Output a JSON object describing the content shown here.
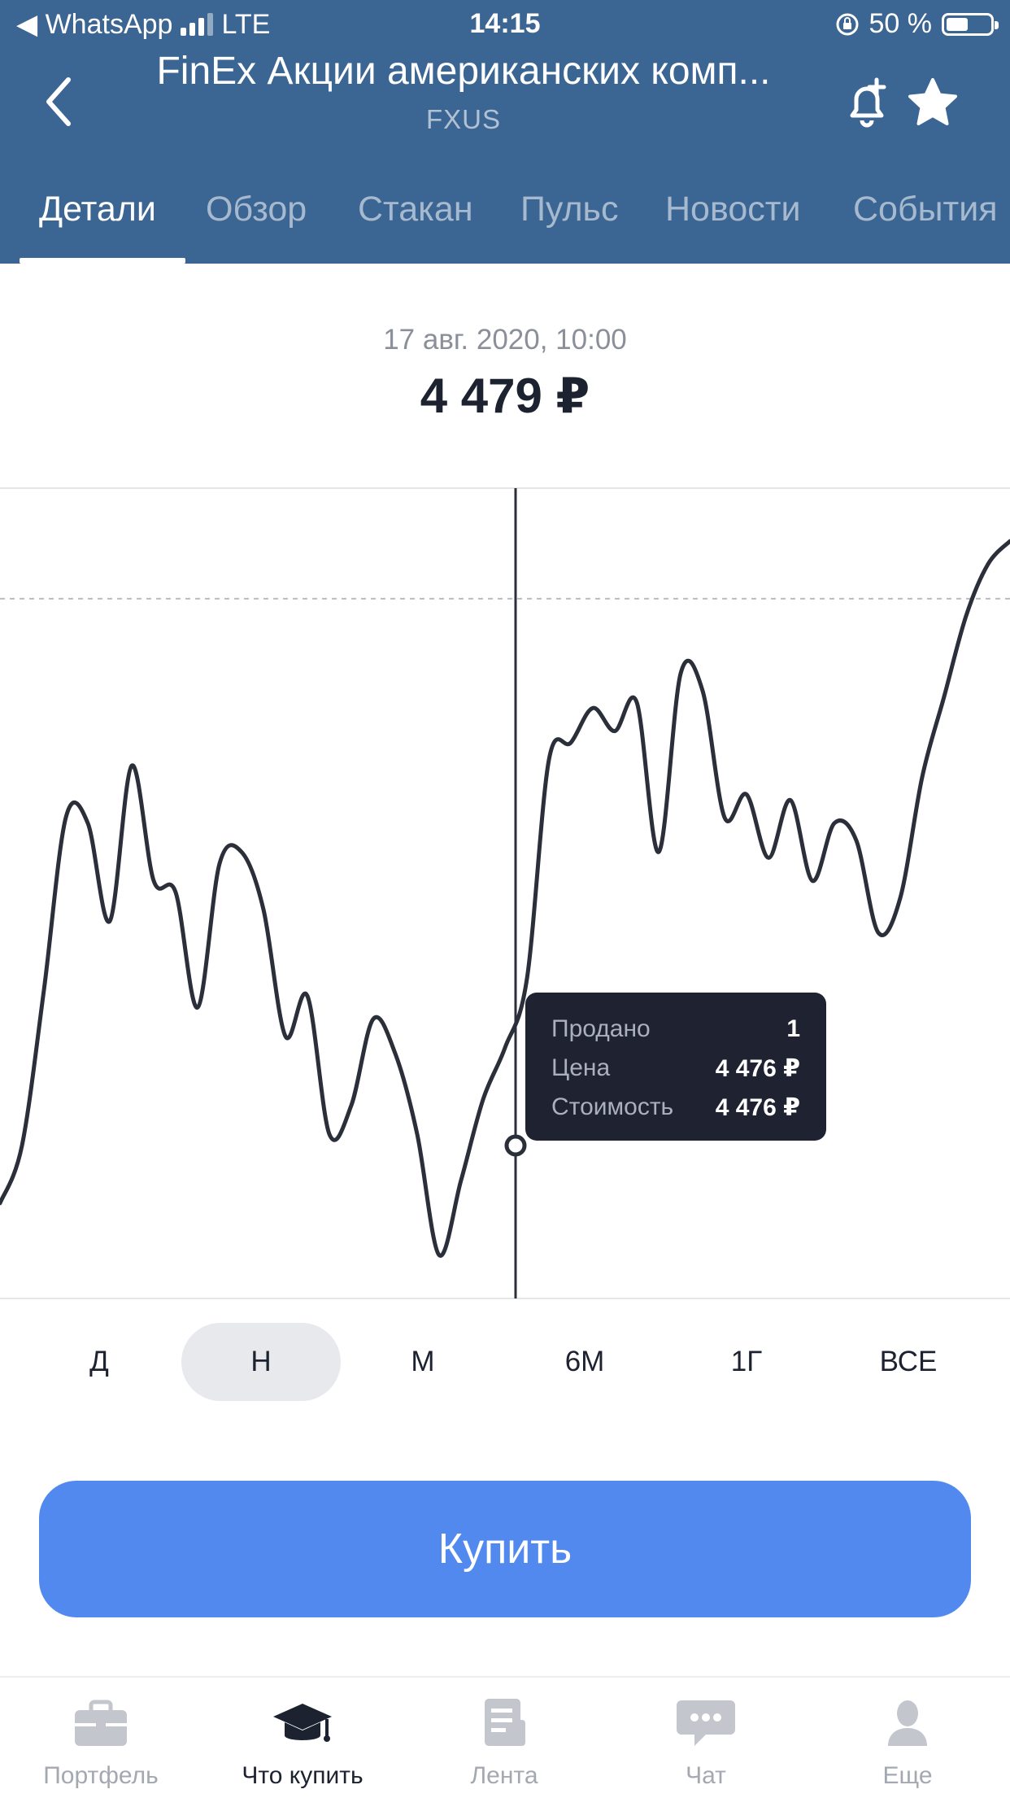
{
  "status_bar": {
    "back_app": "◀ WhatsApp",
    "network": "LTE",
    "time": "14:15",
    "battery": "50 %",
    "battery_level": 0.5
  },
  "header": {
    "title": "FinEx Акции американских комп...",
    "ticker": "FXUS",
    "icons": [
      "back-chevron-icon",
      "bell-plus-icon",
      "star-icon"
    ]
  },
  "tabs": [
    {
      "label": "Детали",
      "active": true
    },
    {
      "label": "Обзор",
      "active": false
    },
    {
      "label": "Стакан",
      "active": false
    },
    {
      "label": "Пульс",
      "active": false
    },
    {
      "label": "Новости",
      "active": false
    },
    {
      "label": "События",
      "active": false
    }
  ],
  "price_header": {
    "date": "17 авг. 2020, 10:00",
    "price": "4 479 ₽"
  },
  "chart_data": {
    "type": "line",
    "series": [
      {
        "values": [
          4374,
          4384,
          4411,
          4441,
          4440,
          4423,
          4450,
          4430,
          4428,
          4408,
          4433,
          4435,
          4425,
          4403,
          4410,
          4386,
          4391,
          4406,
          4400,
          4386,
          4365,
          4378,
          4392,
          4401,
          4413,
          4451,
          4454,
          4460,
          4456,
          4461,
          4435,
          4466,
          4463,
          4441,
          4445,
          4434,
          4444,
          4430,
          4440,
          4437,
          4421,
          4427,
          4448,
          4462,
          4476,
          4485,
          4489
        ]
      }
    ],
    "reference_line": 4479,
    "selected_point": {
      "sold_label": "Продано",
      "sold": "1",
      "price_label": "Цена",
      "price": "4 476 ₽",
      "cost_label": "Стоимость",
      "cost": "4 476 ₽"
    },
    "grid": false,
    "line_color": "#2b2f3a"
  },
  "periods": [
    {
      "label": "Д",
      "active": false
    },
    {
      "label": "Н",
      "active": true
    },
    {
      "label": "М",
      "active": false
    },
    {
      "label": "6М",
      "active": false
    },
    {
      "label": "1Г",
      "active": false
    },
    {
      "label": "ВСЕ",
      "active": false
    }
  ],
  "buy_button": {
    "label": "Купить",
    "color": "#5289ee"
  },
  "bottom_nav": [
    {
      "label": "Портфель",
      "icon": "briefcase-icon",
      "active": false
    },
    {
      "label": "Что купить",
      "icon": "graduation-cap-icon",
      "active": true
    },
    {
      "label": "Лента",
      "icon": "feed-icon",
      "active": false
    },
    {
      "label": "Чат",
      "icon": "chat-bubble-icon",
      "active": false
    },
    {
      "label": "Еще",
      "icon": "profile-icon",
      "active": false
    }
  ],
  "colors": {
    "header_bg": "#3b6593",
    "accent": "#5289ee",
    "text_dark": "#1c2230",
    "text_muted": "#8a8f99"
  }
}
